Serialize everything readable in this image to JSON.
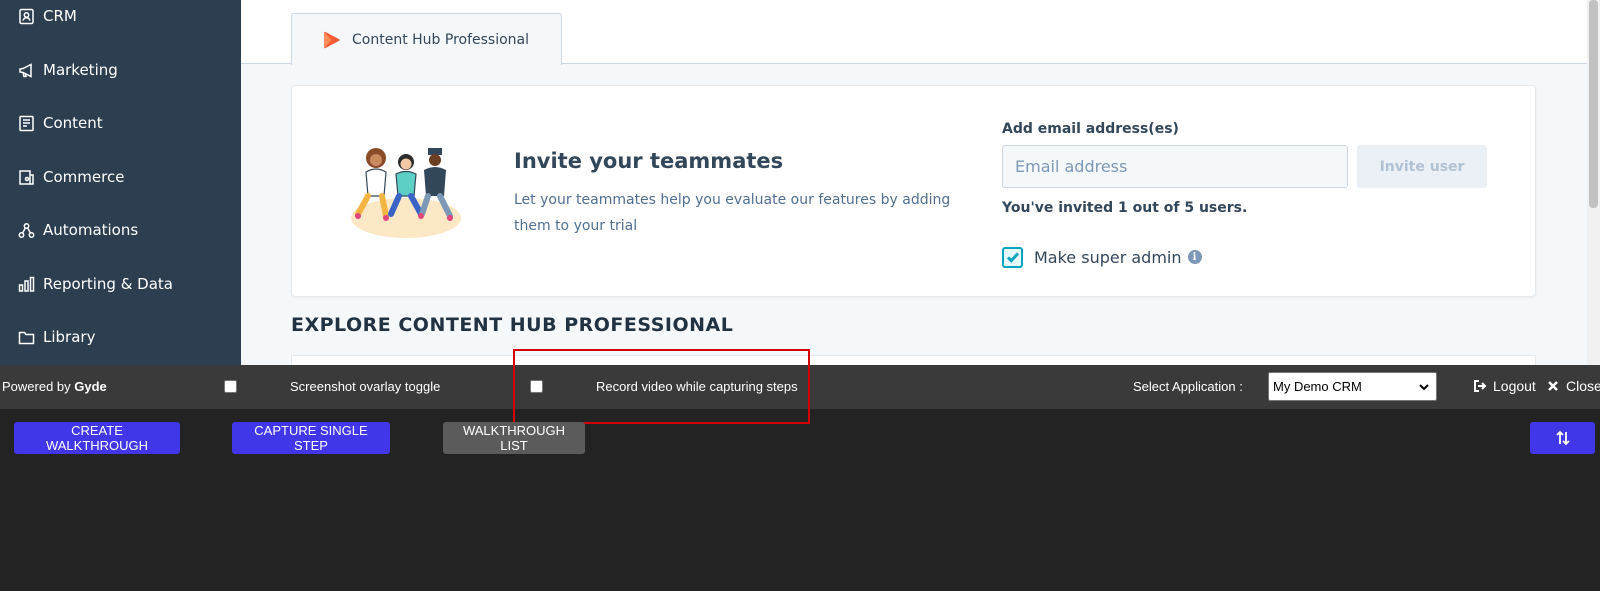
{
  "sidebar": {
    "items": [
      {
        "label": "CRM",
        "icon": "contacts-icon"
      },
      {
        "label": "Marketing",
        "icon": "megaphone-icon"
      },
      {
        "label": "Content",
        "icon": "document-icon"
      },
      {
        "label": "Commerce",
        "icon": "storefront-icon"
      },
      {
        "label": "Automations",
        "icon": "workflow-icon"
      },
      {
        "label": "Reporting & Data",
        "icon": "bar-chart-icon"
      },
      {
        "label": "Library",
        "icon": "folder-icon"
      }
    ]
  },
  "tab": {
    "label": "Content Hub Professional",
    "icon": "content-hub-play-icon"
  },
  "invite": {
    "title": "Invite your teammates",
    "description": "Let your teammates help you evaluate our features by adding them to your trial",
    "email_label": "Add email address(es)",
    "email_placeholder": "Email address",
    "email_value": "",
    "button_label": "Invite user",
    "count_text": "You've invited 1 out of 5 users.",
    "super_admin_label": "Make super admin",
    "super_admin_checked": true
  },
  "explore_title": "EXPLORE CONTENT HUB PROFESSIONAL",
  "gyde": {
    "powered_prefix": "Powered by ",
    "brand": "Gyde",
    "screenshot_toggle_label": "Screenshot ovarlay toggle",
    "record_video_label": "Record video while capturing steps",
    "select_app_label": "Select Application :",
    "selected_app": "My Demo CRM",
    "logout_label": "Logout",
    "close_label": "Close",
    "create_walkthrough": "CREATE WALKTHROUGH",
    "capture_single_step": "CAPTURE SINGLE STEP",
    "walkthrough_list": "WALKTHROUGH LIST",
    "sort_icon": "sort-arrows-icon"
  },
  "colors": {
    "sidebar_bg": "#2d3e50",
    "gyde_bar_bg": "#3a3a3a",
    "gyde_body_bg": "#232323",
    "gyde_primary": "#4137e8",
    "highlight": "#d40000",
    "checkbox_accent": "#00a4bd"
  }
}
